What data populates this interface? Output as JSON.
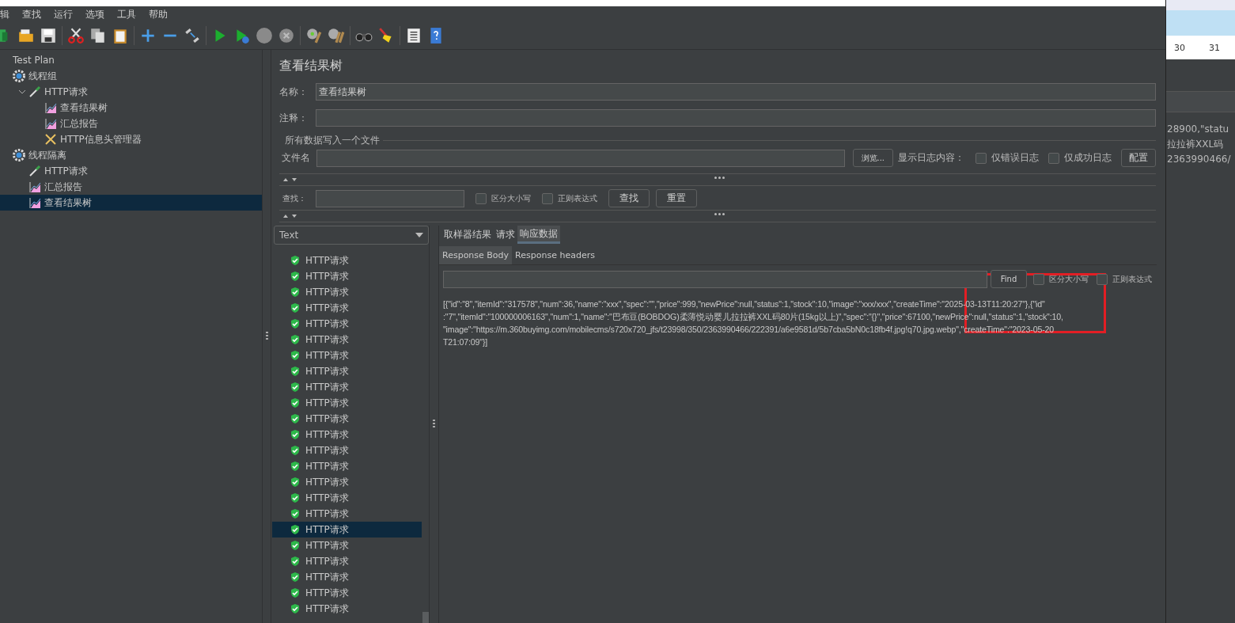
{
  "menu": [
    "辑",
    "查找",
    "运行",
    "选项",
    "工具",
    "帮助"
  ],
  "tree": [
    {
      "label": "Test Plan",
      "selected": false,
      "children": [
        {
          "label": "线程组",
          "kind": "group",
          "selected": false,
          "children": [
            {
              "label": "HTTP请求",
              "kind": "sampler",
              "selected": false,
              "expanded": true,
              "children": [
                {
                  "label": "查看结果树",
                  "kind": "listener",
                  "selected": false
                },
                {
                  "label": "汇总报告",
                  "kind": "listener",
                  "selected": false
                },
                {
                  "label": "HTTP信息头管理器",
                  "kind": "config",
                  "selected": false
                }
              ]
            }
          ]
        },
        {
          "label": "线程隔离",
          "kind": "group",
          "selected": false,
          "children": [
            {
              "label": "HTTP请求",
              "kind": "sampler",
              "selected": false
            },
            {
              "label": "汇总报告",
              "kind": "listener",
              "selected": false
            },
            {
              "label": "查看结果树",
              "kind": "listener",
              "selected": true
            }
          ]
        }
      ]
    }
  ],
  "panel": {
    "title": "查看结果树",
    "name_label": "名称：",
    "name_value": "查看结果树",
    "comment_label": "注释：",
    "group_label": "所有数据写入一个文件",
    "file_label": "文件名",
    "browse": "浏览...",
    "log_label": "显示日志内容：",
    "log_checks": [
      {
        "label": "仅错误日志",
        "checked": false
      },
      {
        "label": "仅成功日志",
        "checked": false
      }
    ],
    "configure": "配置"
  },
  "search": {
    "label": "查找：",
    "checks": [
      {
        "label": "区分大小写",
        "checked": false
      },
      {
        "label": "正则表达式",
        "checked": false
      }
    ],
    "find": "查找",
    "reset": "重置"
  },
  "renderer": "Text",
  "results": [
    {
      "label": "HTTP请求",
      "selected": false
    },
    {
      "label": "HTTP请求",
      "selected": false
    },
    {
      "label": "HTTP请求",
      "selected": false
    },
    {
      "label": "HTTP请求",
      "selected": false
    },
    {
      "label": "HTTP请求",
      "selected": false
    },
    {
      "label": "HTTP请求",
      "selected": false
    },
    {
      "label": "HTTP请求",
      "selected": false
    },
    {
      "label": "HTTP请求",
      "selected": false
    },
    {
      "label": "HTTP请求",
      "selected": false
    },
    {
      "label": "HTTP请求",
      "selected": false
    },
    {
      "label": "HTTP请求",
      "selected": false
    },
    {
      "label": "HTTP请求",
      "selected": false
    },
    {
      "label": "HTTP请求",
      "selected": false
    },
    {
      "label": "HTTP请求",
      "selected": false
    },
    {
      "label": "HTTP请求",
      "selected": false
    },
    {
      "label": "HTTP请求",
      "selected": false
    },
    {
      "label": "HTTP请求",
      "selected": false
    },
    {
      "label": "HTTP请求",
      "selected": true
    },
    {
      "label": "HTTP请求",
      "selected": false
    },
    {
      "label": "HTTP请求",
      "selected": false
    },
    {
      "label": "HTTP请求",
      "selected": false
    },
    {
      "label": "HTTP请求",
      "selected": false
    },
    {
      "label": "HTTP请求",
      "selected": false
    }
  ],
  "tabs": [
    {
      "label": "取样器结果",
      "selected": false
    },
    {
      "label": "请求",
      "selected": false
    },
    {
      "label": "响应数据",
      "selected": true
    }
  ],
  "subtabs": [
    {
      "label": "Response Body",
      "selected": true
    },
    {
      "label": "Response headers",
      "selected": false
    }
  ],
  "body_search": {
    "find": "Find",
    "checks": [
      {
        "label": "区分大小写",
        "checked": false
      },
      {
        "label": "正则表达式",
        "checked": false
      }
    ]
  },
  "response_lines": [
    "[{\"id\":\"8\",\"itemId\":\"317578\",\"num\":36,\"name\":\"xxx\",\"spec\":\"\",\"price\":999,\"newPrice\":null,\"status\":1,\"stock\":10,\"image\":\"xxx/xxx\",\"createTime\":\"2025-03-13T11:20:27\"},{\"id\"",
    ":\"7\",\"itemId\":\"100000006163\",\"num\":1,\"name\":\"巴布豆(BOBDOG)柔薄悦动婴儿拉拉裤XXL码80片(15kg以上)\",\"spec\":\"{}\",\"price\":67100,\"newPrice\":null,\"status\":1,\"stock\":10,",
    "\"image\":\"https://m.360buyimg.com/mobilecms/s720x720_jfs/t23998/350/2363990466/222391/a6e9581d/5b7cba5bN0c18fb4f.jpg!q70.jpg.webp\",\"createTime\":\"2023-05-20",
    "T21:07:09\"}]"
  ],
  "highlight": {
    "color": "#e31e24"
  },
  "side_window": {
    "ruler": [
      "30",
      "31"
    ],
    "lines": [
      "28900,\"statu",
      "拉拉裤XXL码",
      "2363990466/"
    ]
  }
}
